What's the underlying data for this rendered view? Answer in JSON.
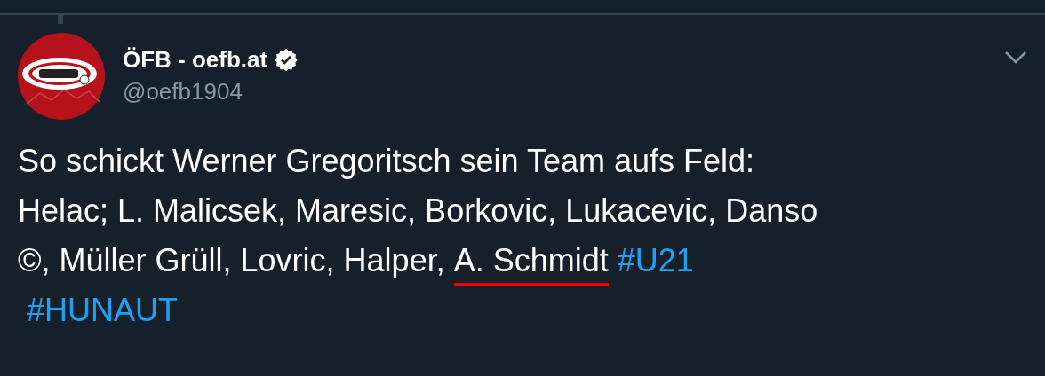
{
  "tweet": {
    "author": {
      "name": "ÖFB - oefb.at",
      "verified": true,
      "handle": "@oefb1904"
    },
    "lines": [
      [
        {
          "kind": "text",
          "text": "So schickt Werner Gregoritsch sein Team aufs Feld:"
        }
      ],
      [
        {
          "kind": "text",
          "text": "Helac; L. Malicsek, Maresic, Borkovic, Lukacevic, Danso"
        }
      ],
      [
        {
          "kind": "text",
          "text": "©, Müller Grüll, Lovric, Halper, "
        },
        {
          "kind": "text",
          "text": "A. Schmidt",
          "underlined": true
        },
        {
          "kind": "hashtag",
          "text": "#U21"
        }
      ],
      [
        {
          "kind": "hashtag",
          "text": "#HUNAUT"
        }
      ]
    ]
  }
}
